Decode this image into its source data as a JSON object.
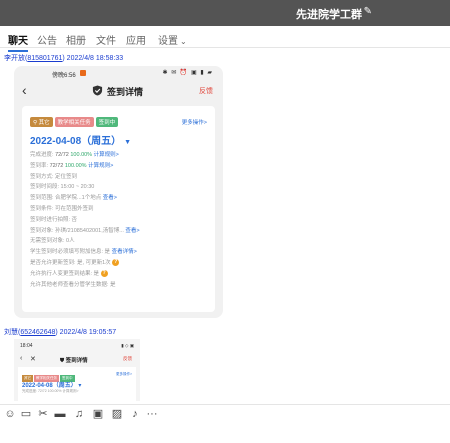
{
  "window": {
    "title": "先进院学工群",
    "edit_icon": "pencil-icon"
  },
  "tabs": [
    {
      "label": "聊天",
      "active": true
    },
    {
      "label": "公告"
    },
    {
      "label": "相册"
    },
    {
      "label": "文件"
    },
    {
      "label": "应用"
    },
    {
      "label": "设置"
    }
  ],
  "messages": [
    {
      "sender": "李开放",
      "qq": "815801761",
      "time": "2022/4/8 18:58:33"
    },
    {
      "sender": "刘慧",
      "qq": "652462648",
      "time": "2022/4/8 19:05:57"
    }
  ],
  "screenshot1": {
    "status_time": "傍晚6:56",
    "status_icons": "✱ ✉ ⏰ ▣ ▮ ▰",
    "nav_title": "签到详情",
    "feedback": "反馈",
    "tags": [
      "其它",
      "教学相关任务",
      "签到中"
    ],
    "more_ops": "更多操作>",
    "date": "2022-04-08（周五）",
    "rows": {
      "progress_label": "完成进度:",
      "progress_count": "72/72",
      "progress_pct": "100.00%",
      "progress_rule": "计算规则>",
      "signed_label": "签到率:",
      "signed_count": "72/72",
      "signed_pct": "100.00%",
      "signed_rule": "计算规则>",
      "method": "签到方式: 定位签到",
      "time": "签到时间段: 15:00 ~ 20:30",
      "range_label": "签到范围: 合肥学院...1个地点",
      "range_link": "查看>",
      "condition": "签到条件: 可在范围外签到",
      "photo": "签到时进行拍照: 否",
      "target_label": "签到对象: 孙琪/21085402001,汤智博...",
      "target_link": "查看>",
      "none_target": "无需签到对象: 0人",
      "info_label": "学生签到时必须填写附加信息: 是",
      "info_link": "查看详情>",
      "update_label": "是否允许更新签到: 是, 可更新1次",
      "executor_label": "允许执行人变更签到结果: 是",
      "other_teacher": "允许其他老师查看分管学生数据: 是"
    }
  },
  "screenshot2": {
    "status_time": "18:04",
    "status_icons": "▮ ◇ ▣",
    "nav_title": "签到详情",
    "feedback": "反馈",
    "tags": [
      "其它",
      "教学相关任务",
      "签到中"
    ],
    "more_ops": "更多操作>",
    "date": "2022-04-08（周五）",
    "row": "完成进度: 72/72 100.00% 计算规则>"
  },
  "toolbar_icons": [
    "emoji-icon",
    "gif-icon",
    "scissors-icon",
    "folder-icon",
    "music-icon",
    "image-icon",
    "picture-icon",
    "bell-icon",
    "more-icon"
  ]
}
